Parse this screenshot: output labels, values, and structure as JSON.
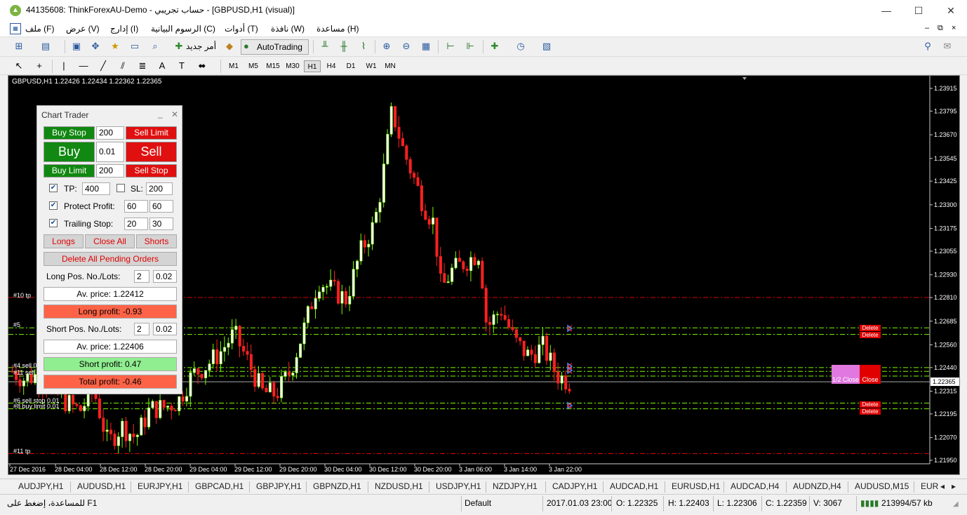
{
  "window": {
    "title": "44135608: ThinkForexAU-Demo - حساب تجريبي - [GBPUSD,H1 (visual)]",
    "minimize": "—",
    "maximize": "☐",
    "close": "✕"
  },
  "menu": {
    "items": [
      "ملف (F)",
      "عرض (V)",
      "إدارج (I)",
      "الرسوم البيانية (C)",
      "أدوات (T)",
      "نافذة (W)",
      "مساعدة (H)"
    ],
    "mdi_controls": [
      "–",
      "⧉",
      "×"
    ]
  },
  "toolbar": {
    "new_order": "أمر جديد",
    "autotrading": "AutoTrading",
    "timeframes": [
      "M1",
      "M5",
      "M15",
      "M30",
      "H1",
      "H4",
      "D1",
      "W1",
      "MN"
    ],
    "active_timeframe": "H1"
  },
  "chart": {
    "header": "GBPUSD,H1  1.22426 1.22434 1.22362 1.22365",
    "price_labels": [
      "1.23915",
      "1.23795",
      "1.23670",
      "1.23545",
      "1.23425",
      "1.23300",
      "1.23175",
      "1.23055",
      "1.22930",
      "1.22810",
      "1.22685",
      "1.22560",
      "1.22440",
      "1.22315",
      "1.22195",
      "1.22070",
      "1.21950"
    ],
    "current_price": "1.22365",
    "time_labels": [
      "27 Dec 2016",
      "28 Dec 04:00",
      "28 Dec 12:00",
      "28 Dec 20:00",
      "29 Dec 04:00",
      "29 Dec 12:00",
      "29 Dec 20:00",
      "30 Dec 04:00",
      "30 Dec 12:00",
      "30 Dec 20:00",
      "3 Jan 06:00",
      "3 Jan 14:00",
      "3 Jan 22:00"
    ],
    "line_labels": {
      "tp10": "#10 tp",
      "sell5": "#5",
      "sell4": "#4 sell 0",
      "sell11": "#11 sell",
      "sellstop6": "#6 sell stop 0.01",
      "buylimit8": "#8 buy limit 0.01",
      "tp11": "#11 tp"
    },
    "order_buttons": {
      "delete": "Delete",
      "half_close": "1/2 Close",
      "close": "Close"
    },
    "colors": {
      "bull": "#ffffff",
      "bear": "#ff2020",
      "wick_bull": "#7CFC00",
      "background": "#000000",
      "tp_line": "#e00000",
      "order_line": "#7CFC00"
    }
  },
  "trader": {
    "title": "Chart Trader",
    "buy_stop": "Buy Stop",
    "buy_stop_pts": "200",
    "sell_limit": "Sell Limit",
    "buy": "Buy",
    "lots": "0.01",
    "sell": "Sell",
    "buy_limit": "Buy Limit",
    "buy_limit_pts": "200",
    "sell_stop": "Sell Stop",
    "tp_label": "TP:",
    "tp_value": "400",
    "sl_label": "SL:",
    "sl_value": "200",
    "protect_label": "Protect Profit:",
    "protect_a": "60",
    "protect_b": "60",
    "trailing_label": "Trailing Stop:",
    "trailing_a": "20",
    "trailing_b": "30",
    "longs": "Longs",
    "close_all": "Close All",
    "shorts": "Shorts",
    "delete_pending": "Delete All Pending Orders",
    "long_pos_label": "Long Pos. No./Lots:",
    "long_no": "2",
    "long_lots": "0.02",
    "long_av": "Av. price: 1.22412",
    "long_profit": "Long profit: -0.93",
    "short_pos_label": "Short Pos. No./Lots:",
    "short_no": "2",
    "short_lots": "0.02",
    "short_av": "Av. price: 1.22406",
    "short_profit": "Short profit: 0.47",
    "total_profit": "Total profit: -0.46"
  },
  "symbol_tabs": [
    "AUDJPY,H1",
    "AUDUSD,H1",
    "EURJPY,H1",
    "GBPCAD,H1",
    "GBPJPY,H1",
    "GBPNZD,H1",
    "NZDUSD,H1",
    "USDJPY,H1",
    "NZDJPY,H1",
    "CADJPY,H1",
    "AUDCAD,H1",
    "EURUSD,H1",
    "AUDCAD,H4",
    "AUDNZD,H4",
    "AUDUSD,M15",
    "EUR"
  ],
  "status": {
    "help": "للمساعدة، إضغط على  F1",
    "profile": "Default",
    "datetime": "2017.01.03 23:00",
    "open": "O: 1.22325",
    "high": "H: 1.22403",
    "low": "L: 1.22306",
    "close": "C: 1.22359",
    "volume": "V: 3067",
    "traffic": "213994/57 kb"
  }
}
